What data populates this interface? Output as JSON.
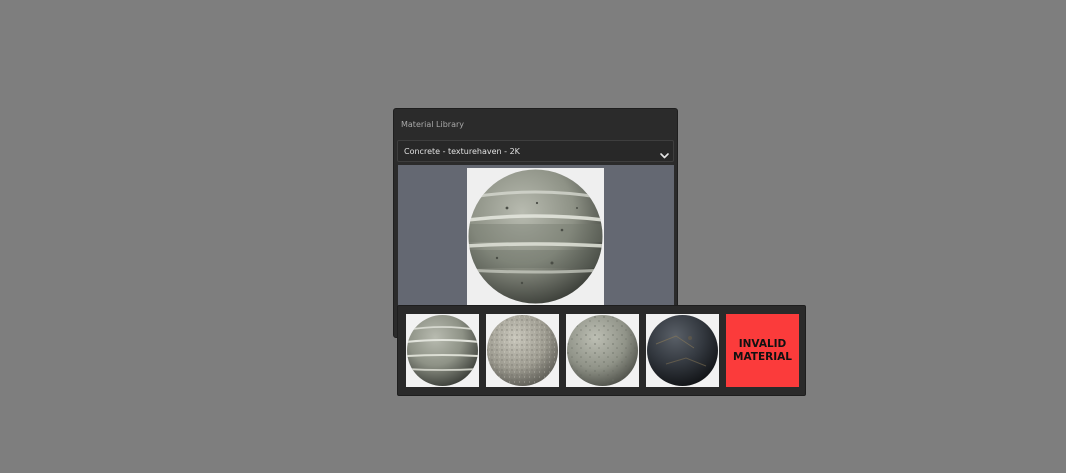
{
  "panel": {
    "title": "Material Library",
    "dropdown": {
      "selected": "Concrete - texturehaven - 2K",
      "icon": "chevron-down-icon"
    },
    "preview": {
      "material": "concrete-striped-sphere"
    }
  },
  "strip": {
    "thumbnails": [
      {
        "material": "concrete-striped-sphere"
      },
      {
        "material": "concrete-aggregate-sphere"
      },
      {
        "material": "concrete-smooth-sphere"
      },
      {
        "material": "dark-stone-sphere"
      }
    ],
    "invalid_label": "INVALID\nMATERIAL"
  },
  "colors": {
    "background": "#7e7e7e",
    "panel": "#2b2b2b",
    "preview_area": "#646872",
    "invalid": "#fb3b3b"
  }
}
